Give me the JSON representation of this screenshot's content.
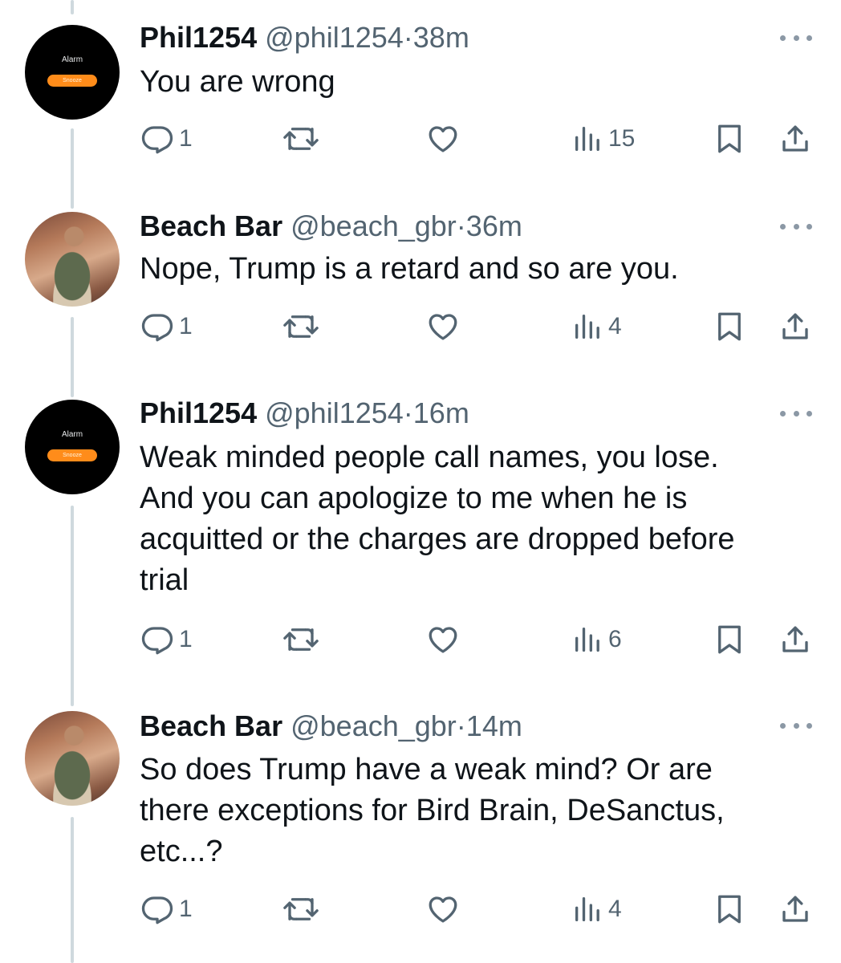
{
  "tweets": [
    {
      "author": "Phil1254",
      "handle": "@phil1254",
      "separator": "·",
      "time": "38m",
      "text": "You are wrong",
      "replies": "1",
      "views": "15",
      "avatar": {
        "title": "Alarm",
        "button": "Snooze"
      }
    },
    {
      "author": "Beach Bar",
      "handle": "@beach_gbr",
      "separator": "·",
      "time": "36m",
      "text": "Nope, Trump is a retard and so are you.",
      "replies": "1",
      "views": "4"
    },
    {
      "author": "Phil1254",
      "handle": "@phil1254",
      "separator": "·",
      "time": "16m",
      "text": "Weak minded people call names, you lose.\nAnd you can apologize to me when he is\nacquitted or the charges are dropped before\ntrial",
      "replies": "1",
      "views": "6",
      "avatar": {
        "title": "Alarm",
        "button": "Snooze"
      }
    },
    {
      "author": "Beach Bar",
      "handle": "@beach_gbr",
      "separator": "·",
      "time": "14m",
      "text": "So does Trump have a weak mind? Or are\nthere exceptions for Bird Brain, DeSanctus,\netc...?",
      "replies": "1",
      "views": "4"
    }
  ],
  "icons": {
    "reply": "reply-icon",
    "retweet": "retweet-icon",
    "like": "heart-icon",
    "views": "views-icon",
    "bookmark": "bookmark-icon",
    "share": "share-icon",
    "more": "more-options-icon"
  },
  "colors": {
    "text": "#0f1419",
    "secondary": "#536471",
    "thread_line": "#cfd9de",
    "alarm_accent": "#ff8c1a"
  }
}
